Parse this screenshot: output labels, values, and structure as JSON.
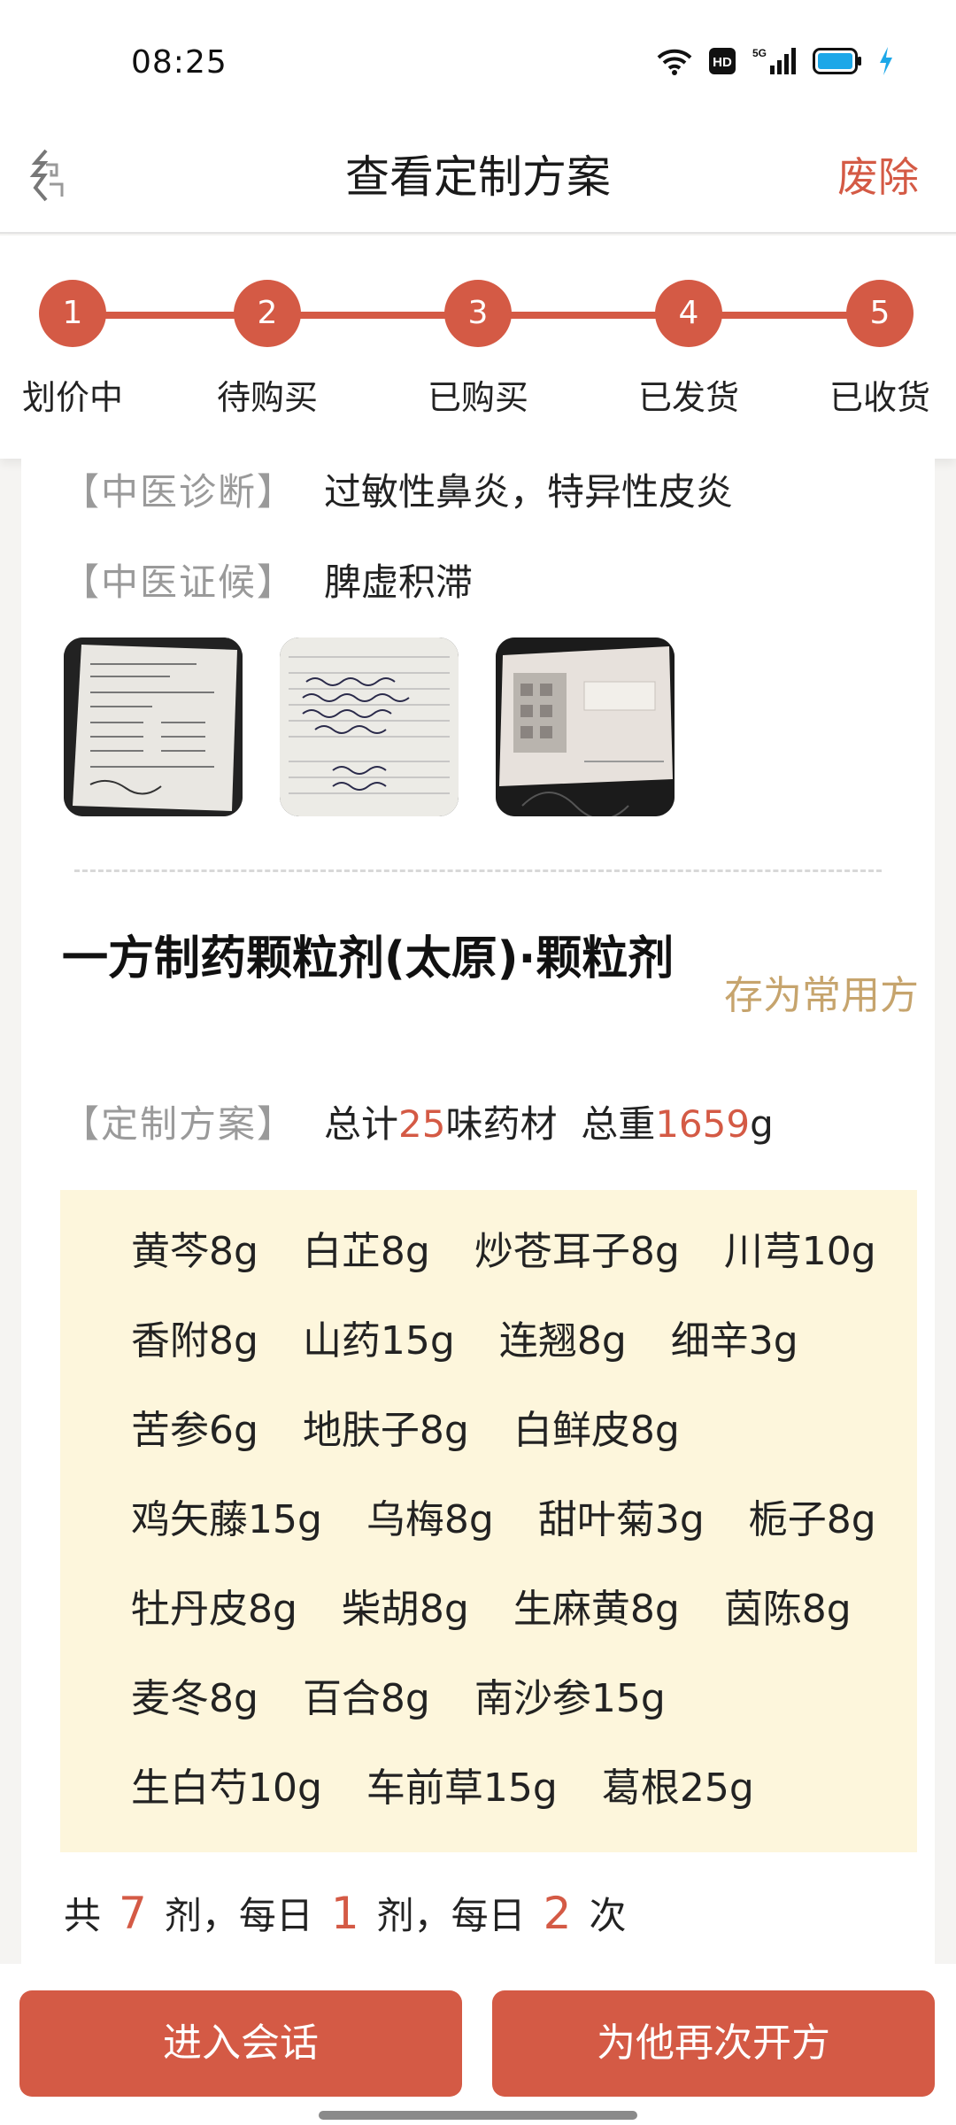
{
  "status_bar": {
    "time": "08:25",
    "icons": [
      "wifi-icon",
      "hd-icon",
      "signal-5g-icon",
      "battery-icon",
      "charging-icon"
    ],
    "hd_label": "HD",
    "network_label": "5G"
  },
  "header": {
    "back_icon": "back-icon",
    "title": "查看定制方案",
    "action_label": "废除"
  },
  "steps": [
    {
      "number": "1",
      "label": "划价中"
    },
    {
      "number": "2",
      "label": "待购买"
    },
    {
      "number": "3",
      "label": "已购买"
    },
    {
      "number": "4",
      "label": "已发货"
    },
    {
      "number": "5",
      "label": "已收货"
    }
  ],
  "diagnosis": {
    "tcm_diagnosis_label": "【中医诊断】",
    "tcm_diagnosis_value": "过敏性鼻炎，特异性皮炎",
    "tcm_syndrome_label": "【中医证候】",
    "tcm_syndrome_value": "脾虚积滞"
  },
  "attachments": [
    "medical-record-photo-1",
    "medical-record-photo-2",
    "outpatient-record-booklet-photo"
  ],
  "formula": {
    "name": "一方制药颗粒剂(太原)·颗粒剂",
    "save_label": "存为常用方",
    "plan_label": "【定制方案】",
    "total_prefix": "总计",
    "total_count": "25",
    "total_suffix": "味药材",
    "weight_prefix": "总重",
    "total_weight": "1659",
    "weight_unit": "g"
  },
  "herb_rows": [
    [
      "黄芩8g",
      "白芷8g",
      "炒苍耳子8g",
      "川芎10g"
    ],
    [
      "香附8g",
      "山药15g",
      "连翘8g",
      "细辛3g"
    ],
    [
      "苦参6g",
      "地肤子8g",
      "白鲜皮8g"
    ],
    [
      "鸡矢藤15g",
      "乌梅8g",
      "甜叶菊3g",
      "栀子8g"
    ],
    [
      "牡丹皮8g",
      "柴胡8g",
      "生麻黄8g",
      "茵陈8g"
    ],
    [
      "麦冬8g",
      "百合8g",
      "南沙参15g"
    ],
    [
      "生白芍10g",
      "车前草15g",
      "葛根25g"
    ]
  ],
  "dosage": {
    "t1": "共",
    "doses": "7",
    "t2": "剂，每日",
    "per_day": "1",
    "t3": "剂，每日",
    "times": "2",
    "t4": "次"
  },
  "buttons": {
    "enter_chat": "进入会话",
    "prescribe_again": "为他再次开方"
  },
  "colors": {
    "accent": "#d45a45",
    "gold": "#c6a46d",
    "herb_box_bg": "#fdf6dc",
    "battery": "#1ca7e8"
  }
}
